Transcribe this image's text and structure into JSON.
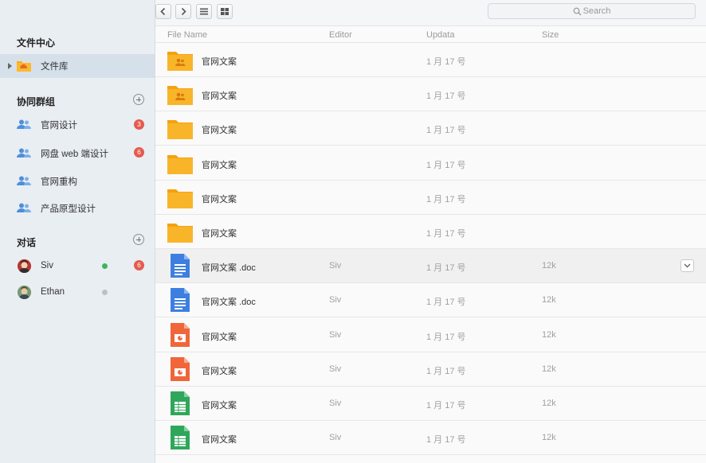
{
  "toolbar": {
    "search_placeholder": "Search"
  },
  "sidebar": {
    "files_section": "文件中心",
    "library_label": "文件库",
    "groups_section": "协同群组",
    "groups": [
      {
        "label": "官网设计",
        "badge": "3"
      },
      {
        "label": "网盘 web 端设计",
        "badge": "6"
      },
      {
        "label": "官网重构",
        "badge": ""
      },
      {
        "label": "产品原型设计",
        "badge": ""
      }
    ],
    "chats_section": "对话",
    "chats": [
      {
        "label": "Siv",
        "status": "online",
        "badge": "6"
      },
      {
        "label": "Ethan",
        "status": "offline",
        "badge": ""
      }
    ]
  },
  "table": {
    "headers": {
      "name": "File Name",
      "editor": "Editor",
      "date": "Updata",
      "size": "Size"
    },
    "rows": [
      {
        "icon": "shared-folder-icon",
        "name": "官网文案",
        "editor": "",
        "date": "1 月 17 号",
        "size": ""
      },
      {
        "icon": "shared-folder-icon",
        "name": "官网文案",
        "editor": "",
        "date": "1 月 17 号",
        "size": ""
      },
      {
        "icon": "folder-icon",
        "name": "官网文案",
        "editor": "",
        "date": "1 月 17 号",
        "size": ""
      },
      {
        "icon": "folder-icon",
        "name": "官网文案",
        "editor": "",
        "date": "1 月 17 号",
        "size": ""
      },
      {
        "icon": "folder-icon",
        "name": "官网文案",
        "editor": "",
        "date": "1 月 17 号",
        "size": ""
      },
      {
        "icon": "folder-icon",
        "name": "官网文案",
        "editor": "",
        "date": "1 月 17 号",
        "size": ""
      },
      {
        "icon": "doc-file-icon",
        "name": "官网文案 .doc",
        "editor": "Siv",
        "date": "1 月 17 号",
        "size": "12k"
      },
      {
        "icon": "doc-file-icon",
        "name": "官网文案 .doc",
        "editor": "Siv",
        "date": "1 月 17 号",
        "size": "12k"
      },
      {
        "icon": "ppt-file-icon",
        "name": "官网文案",
        "editor": "Siv",
        "date": "1 月 17 号",
        "size": "12k"
      },
      {
        "icon": "ppt-file-icon",
        "name": "官网文案",
        "editor": "Siv",
        "date": "1 月 17 号",
        "size": "12k"
      },
      {
        "icon": "sheet-file-icon",
        "name": "官网文案",
        "editor": "Siv",
        "date": "1 月 17 号",
        "size": "12k"
      },
      {
        "icon": "sheet-file-icon",
        "name": "官网文案",
        "editor": "Siv",
        "date": "1 月 17 号",
        "size": "12k"
      }
    ]
  },
  "colors": {
    "folder": "#f9ad1c",
    "doc": "#3d7fe0",
    "ppt": "#f0663a",
    "sheet": "#2fa75b",
    "badge": "#e55a4e",
    "online": "#3cb55e",
    "offline": "#bfbfbf",
    "group_icon": "#4d8fd9"
  }
}
